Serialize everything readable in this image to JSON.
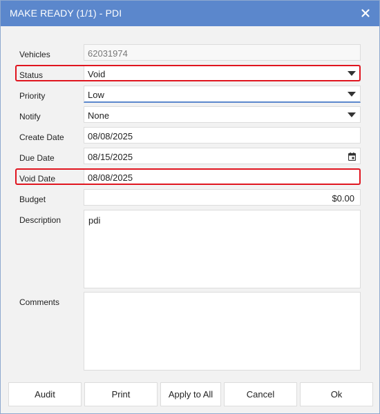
{
  "window": {
    "title": "MAKE READY (1/1) - PDI"
  },
  "form": {
    "vehicles": {
      "label": "Vehicles",
      "value": "62031974"
    },
    "status": {
      "label": "Status",
      "value": "Void"
    },
    "priority": {
      "label": "Priority",
      "value": "Low"
    },
    "notify": {
      "label": "Notify",
      "value": "None"
    },
    "create_date": {
      "label": "Create Date",
      "value": "08/08/2025"
    },
    "due_date": {
      "label": "Due Date",
      "value": "08/15/2025"
    },
    "void_date": {
      "label": "Void Date",
      "value": "08/08/2025"
    },
    "budget": {
      "label": "Budget",
      "value": "$0.00"
    },
    "description": {
      "label": "Description",
      "value": "pdi"
    },
    "comments": {
      "label": "Comments",
      "value": ""
    }
  },
  "buttons": {
    "audit": "Audit",
    "print": "Print",
    "apply_to_all": "Apply to All",
    "cancel": "Cancel",
    "ok": "Ok"
  },
  "colors": {
    "titlebar": "#5b87cc",
    "highlight": "#e0141e",
    "background": "#f2f2f2"
  },
  "icons": {
    "close": "close-icon",
    "dropdown": "chevron-down-icon",
    "calendar": "calendar-icon"
  }
}
